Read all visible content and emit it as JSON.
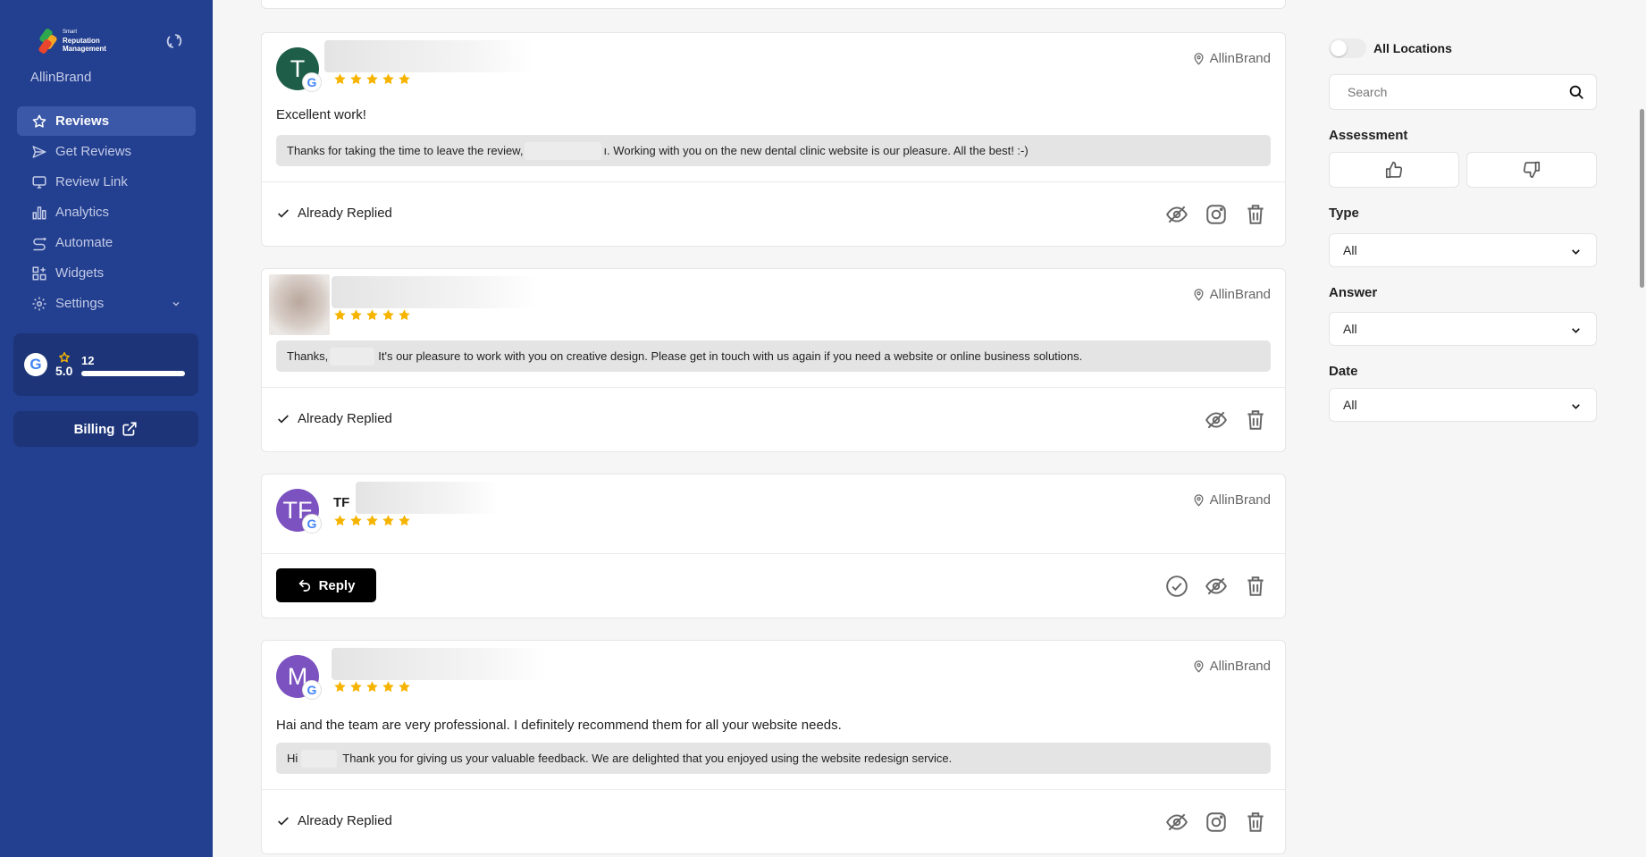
{
  "sidebar": {
    "logo": {
      "line1": "Smart",
      "line2": "Reputation",
      "line3": "Management"
    },
    "brand": "AllinBrand",
    "nav": [
      {
        "label": "Reviews",
        "icon": "star-icon",
        "active": true
      },
      {
        "label": "Get Reviews",
        "icon": "send-icon"
      },
      {
        "label": "Review Link",
        "icon": "monitor-icon"
      },
      {
        "label": "Analytics",
        "icon": "bar-chart-icon"
      },
      {
        "label": "Automate",
        "icon": "automate-icon"
      },
      {
        "label": "Widgets",
        "icon": "widgets-icon"
      },
      {
        "label": "Settings",
        "icon": "gear-icon"
      }
    ],
    "rating": {
      "platform": "G",
      "score": "5.0",
      "count": "12",
      "fill": 1.0
    },
    "billing_label": "Billing"
  },
  "reviews": [
    {
      "avatar_letter": "T",
      "avatar_color": "#1e5e48",
      "stars": 5,
      "location": "AllinBrand",
      "text": "Excellent work!",
      "reply_before": "Thanks for taking the time to leave the review,",
      "reply_after": "ı. Working with you on the new dental clinic website is our pleasure. All the best! :-)",
      "status": "Already Replied"
    },
    {
      "avatar_letter": "",
      "stars": 5,
      "location": "AllinBrand",
      "text": "",
      "reply_before": "Thanks,",
      "reply_after": "It's our pleasure to work with you on creative design. Please get in touch with us again if you need a website or online business solutions.",
      "status": "Already Replied"
    },
    {
      "avatar_letter": "TF",
      "avatar_color": "#7b52c0",
      "author": "TF",
      "stars": 5,
      "location": "AllinBrand",
      "reply_label": "Reply"
    },
    {
      "avatar_letter": "M",
      "avatar_color": "#7b52c0",
      "stars": 5,
      "location": "AllinBrand",
      "text": "Hai and the team are very professional. I definitely recommend them for all your website needs.",
      "reply_before": "Hi",
      "reply_after": "Thank you for giving us your valuable feedback. We are delighted that you enjoyed using the website redesign service.",
      "status": "Already Replied"
    }
  ],
  "filters": {
    "all_locations": "All Locations",
    "search_placeholder": "Search",
    "assessment_label": "Assessment",
    "type_label": "Type",
    "type_value": "All",
    "answer_label": "Answer",
    "answer_value": "All",
    "date_label": "Date",
    "date_value": "All"
  },
  "colors": {
    "sidebar": "#233f8f",
    "star": "#f6b400",
    "accent_blue": "#4285f4"
  }
}
